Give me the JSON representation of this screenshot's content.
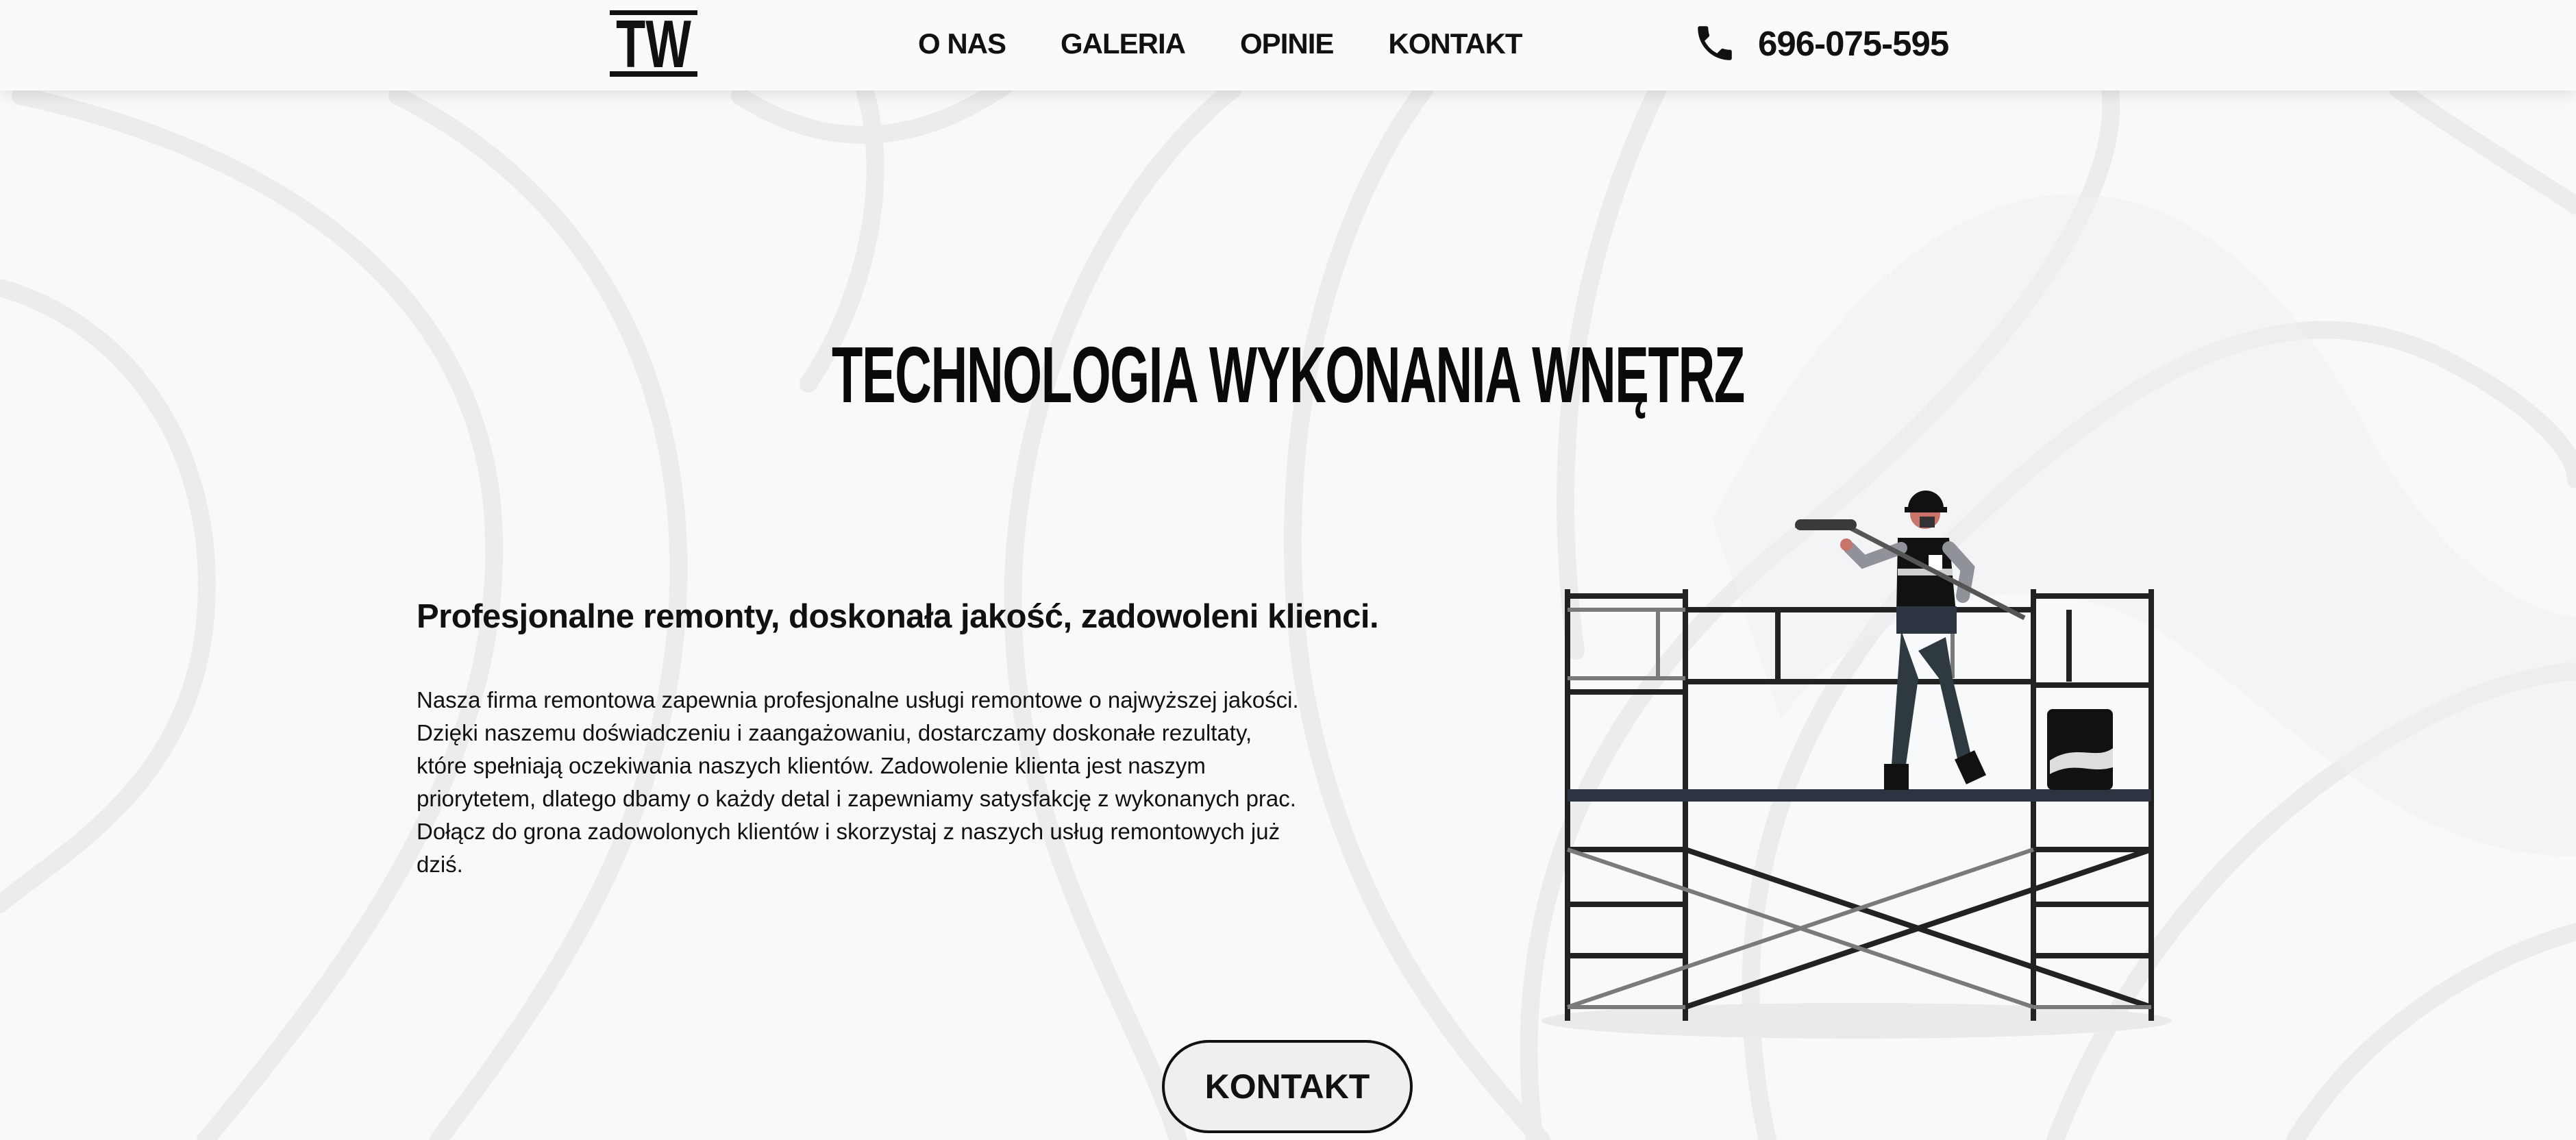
{
  "nav": {
    "logo_text": "TW",
    "links": [
      "O NAS",
      "GALERIA",
      "OPINIE",
      "KONTAKT"
    ],
    "phone_icon": "phone-icon",
    "phone_number": "696-075-595"
  },
  "hero": {
    "title": "TECHNOLOGIA WYKONANIA WNĘTRZ",
    "tagline": "Profesjonalne remonty, doskonała jakość, zadowoleni klienci.",
    "description": "Nasza firma remontowa zapewnia profesjonalne usługi remontowe o najwyższej jakości. Dzięki naszemu doświadczeniu i zaangażowaniu, dostarczamy doskonałe rezultaty, które spełniają oczekiwania naszych klientów. Zadowolenie klienta jest naszym priorytetem, dlatego dbamy o każdy detal i zapewniamy satysfakcję z wykonanych prac. Dołącz do grona zadowolonych klientów i skorzystaj z naszych usług remontowych już dziś.",
    "illustration": "worker-on-scaffolding-illustration",
    "cta_label": "KONTAKT"
  },
  "colors": {
    "background": "#f8f9fb",
    "navbar": "#f9fafb",
    "swirl": "#eaebed",
    "text": "#111111",
    "button_bg": "#efefef"
  }
}
